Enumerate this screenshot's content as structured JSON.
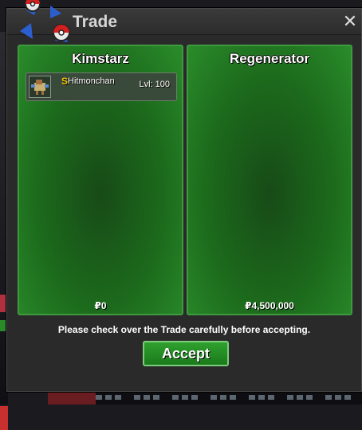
{
  "window": {
    "title": "Trade",
    "close_glyph": "✕"
  },
  "left_panel": {
    "player": "Kimstarz",
    "money": "₽0",
    "items": [
      {
        "icon": "pokemon-sprite-icon",
        "shiny_marker": "S",
        "name": "Hitmonchan",
        "level": "Lvl: 100"
      }
    ]
  },
  "right_panel": {
    "player": "Regenerator",
    "money": "₽4,500,000"
  },
  "footer": {
    "notice": "Please check over the Trade carefully before accepting.",
    "accept_label": "Accept"
  },
  "colors": {
    "panel_green": "#1c6a1c",
    "panel_border": "#3f9a3f",
    "accept_green": "#2fa02f",
    "shiny_gold": "#f2c400"
  }
}
